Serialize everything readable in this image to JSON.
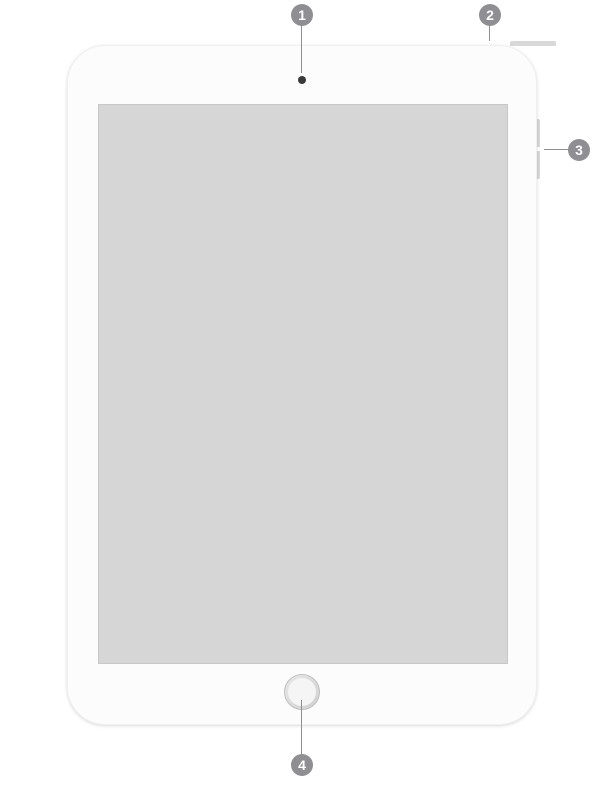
{
  "diagram": {
    "device": "tablet-front-view",
    "callouts": [
      {
        "id": "1",
        "target": "front-camera"
      },
      {
        "id": "2",
        "target": "top-button"
      },
      {
        "id": "3",
        "target": "volume-buttons"
      },
      {
        "id": "4",
        "target": "home-button"
      }
    ],
    "badge_color": "#8e8e93",
    "badge_text_color": "#ffffff",
    "screen_color": "#d6d6d6",
    "body_color": "#fcfcfc"
  }
}
